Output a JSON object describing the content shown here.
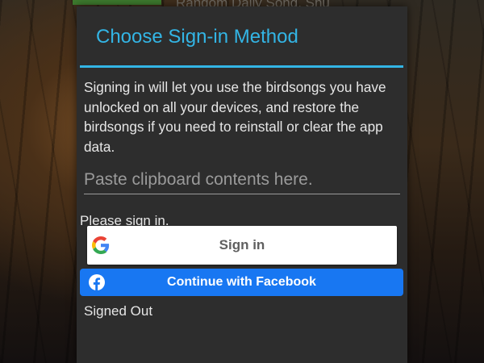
{
  "background": {
    "app_title": "Random Daily Song, Shu"
  },
  "dialog": {
    "title": "Choose Sign-in Method",
    "description": "Signing in will let you use the birdsongs you have unlocked on all your devices, and restore the birdsongs if you need to reinstall or clear the app data.",
    "paste_field": {
      "value": "",
      "placeholder": "Paste clipboard contents here."
    },
    "sign_in_prompt": "Please sign in.",
    "google_button": {
      "label": "Sign in",
      "icon": "google-icon"
    },
    "facebook_button": {
      "label": "Continue with Facebook",
      "icon": "facebook-icon"
    },
    "auth_status": "Signed Out"
  },
  "colors": {
    "accent": "#33b5e5",
    "dialog_bg": "#2d2d2d",
    "facebook_blue": "#1877f2"
  }
}
